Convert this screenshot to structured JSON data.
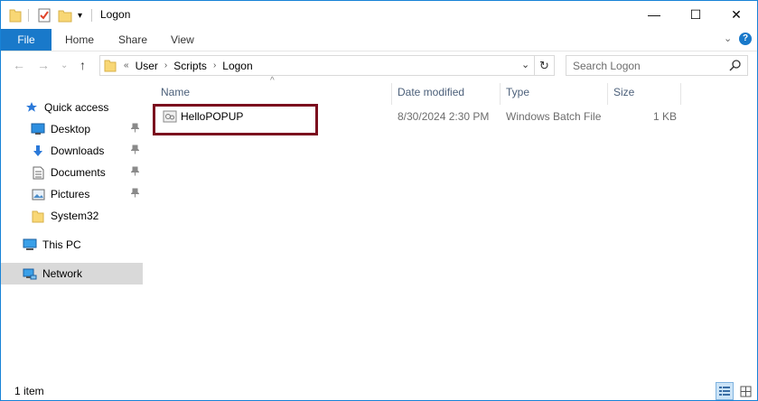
{
  "window": {
    "title": "Logon",
    "controls": {
      "minimize": "—",
      "maximize": "☐",
      "close": "✕"
    }
  },
  "ribbon": {
    "tabs": [
      "File",
      "Home",
      "Share",
      "View"
    ],
    "collapse": "⌄",
    "help": "?"
  },
  "address": {
    "prefix": "«",
    "crumbs": [
      "User",
      "Scripts",
      "Logon"
    ],
    "separator": "›",
    "dropdown": "⌄",
    "refresh": "↻"
  },
  "search": {
    "placeholder": "Search Logon"
  },
  "nav": {
    "quick_access": "Quick access",
    "items": [
      {
        "label": "Desktop",
        "icon": "desktop-icon",
        "pinned": true
      },
      {
        "label": "Downloads",
        "icon": "download-icon",
        "pinned": true
      },
      {
        "label": "Documents",
        "icon": "documents-icon",
        "pinned": true
      },
      {
        "label": "Pictures",
        "icon": "pictures-icon",
        "pinned": true
      },
      {
        "label": "System32",
        "icon": "folder-icon",
        "pinned": false
      }
    ],
    "this_pc": "This PC",
    "network": "Network",
    "pin_glyph": "📌"
  },
  "columns": [
    "Name",
    "Date modified",
    "Type",
    "Size"
  ],
  "files": [
    {
      "name": "HelloPOPUP",
      "date": "8/30/2024 2:30 PM",
      "type": "Windows Batch File",
      "size": "1 KB",
      "highlighted": true
    }
  ],
  "status": {
    "count": "1 item"
  },
  "colors": {
    "accent": "#1979ca",
    "highlight_border": "#7b0d1e",
    "folder": "#f8d775",
    "selected_nav": "#d9d9d9"
  }
}
